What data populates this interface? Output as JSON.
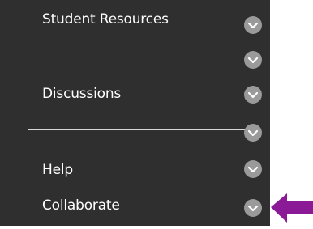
{
  "menu": {
    "items": [
      {
        "label": "Student Resources",
        "icon": "chevron-down-icon"
      },
      {
        "label": "Discussions",
        "icon": "chevron-down-icon"
      },
      {
        "label": "Help",
        "icon": "chevron-down-icon"
      },
      {
        "label": "Collaborate",
        "icon": "chevron-down-icon"
      }
    ],
    "dividers": [
      {
        "icon": "chevron-down-icon"
      },
      {
        "icon": "chevron-down-icon"
      }
    ]
  },
  "colors": {
    "menu_background": "#2f2f2f",
    "text": "#ffffff",
    "chevron_circle": "#9a9a9a",
    "divider": "#d8d8d8",
    "callout_arrow": "#8a1a96"
  },
  "annotation": {
    "icon": "arrow-left-icon"
  }
}
